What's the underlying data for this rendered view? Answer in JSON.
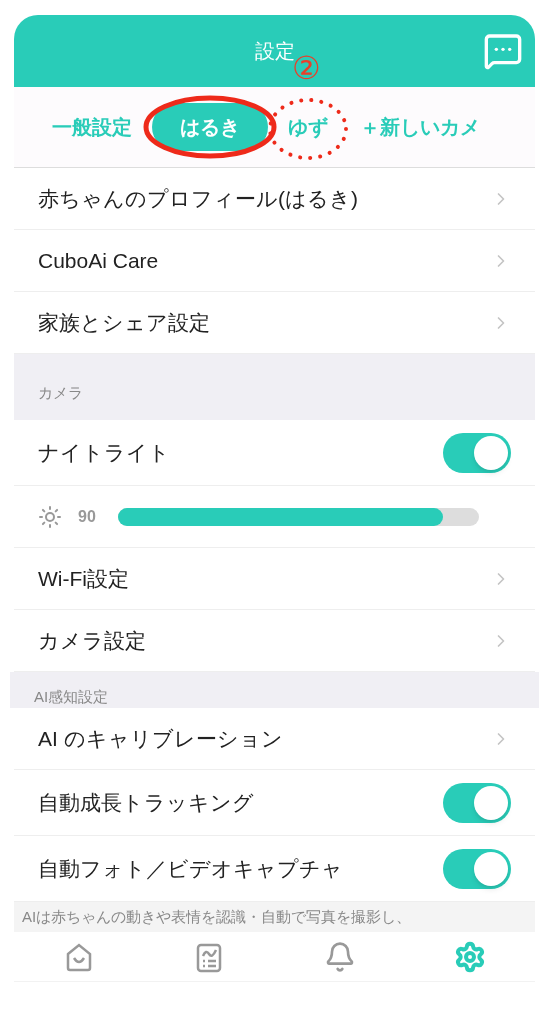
{
  "header": {
    "title": "設定"
  },
  "annotation": {
    "mark": "②"
  },
  "tabs": [
    {
      "label": "一般設定",
      "selected": false
    },
    {
      "label": "はるき",
      "selected": true
    },
    {
      "label": "ゆず",
      "selected": false
    },
    {
      "label": "＋新しいカメ",
      "selected": false
    }
  ],
  "sections": [
    {
      "rows": [
        {
          "kind": "link",
          "label": "赤ちゃんのプロフィール(はるき)"
        },
        {
          "kind": "link",
          "label": "CuboAi Care"
        },
        {
          "kind": "link",
          "label": "家族とシェア設定"
        }
      ]
    },
    {
      "title": "カメラ",
      "rows": [
        {
          "kind": "toggle",
          "label": "ナイトライト",
          "on": true
        },
        {
          "kind": "slider",
          "reading": "90",
          "level": 0.9
        },
        {
          "kind": "link",
          "label": "Wi-Fi設定"
        },
        {
          "kind": "link",
          "label": "カメラ設定"
        }
      ]
    },
    {
      "title": "AI感知設定",
      "rows": [
        {
          "kind": "link",
          "label": "AI のキャリブレーション"
        },
        {
          "kind": "toggle",
          "label": "自動成長トラッキング",
          "on": true
        },
        {
          "kind": "toggle",
          "label": "自動フォト／ビデオキャプチャ",
          "on": true
        }
      ]
    }
  ],
  "footnote": "AIは赤ちゃんの動きや表情を認識・自動で写真を撮影し、",
  "tab_bar": [
    {
      "kind": "home",
      "selected": false
    },
    {
      "kind": "report",
      "selected": false
    },
    {
      "kind": "bell",
      "selected": false
    },
    {
      "kind": "gear",
      "selected": true
    }
  ]
}
